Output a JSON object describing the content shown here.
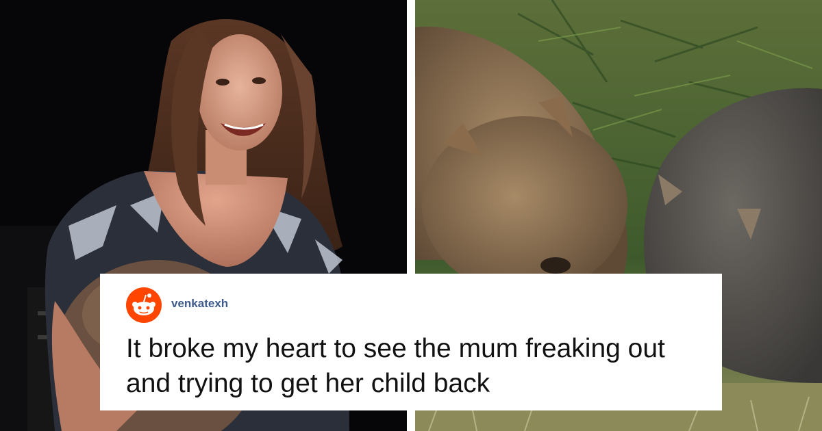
{
  "images": {
    "left": {
      "alt": "Woman at night holding a wombat"
    },
    "right": {
      "alt": "Two wombats in grass"
    }
  },
  "post": {
    "platform_icon": "reddit-alien-icon",
    "brand_color": "#ff4500",
    "username": "venkatexh",
    "comment": "It broke my heart to see the mum freaking out and trying to get her child back"
  }
}
